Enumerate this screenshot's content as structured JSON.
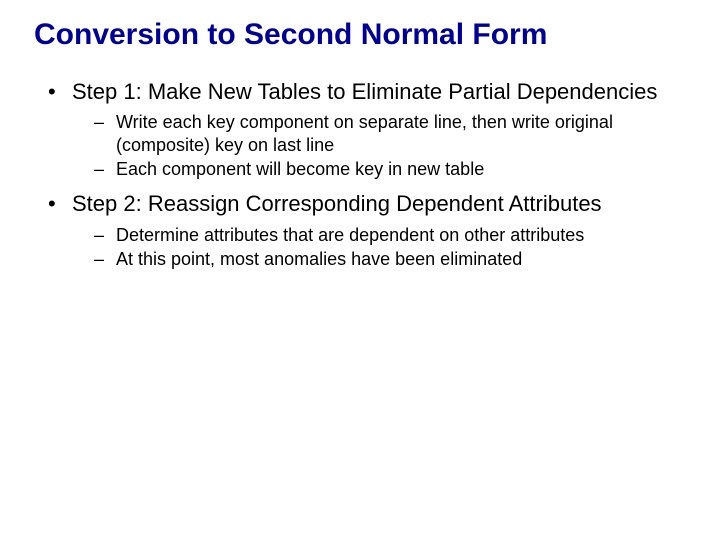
{
  "title": "Conversion to Second Normal Form",
  "bullets": [
    {
      "text": "Step 1: Make New Tables to Eliminate Partial Dependencies",
      "sub": [
        "Write each key component on separate line, then write original (composite) key on last line",
        "Each component will become key in new table"
      ]
    },
    {
      "text": "Step 2: Reassign Corresponding Dependent Attributes",
      "sub": [
        "Determine attributes that are dependent on other attributes",
        "At this point, most anomalies have been eliminated"
      ]
    }
  ]
}
